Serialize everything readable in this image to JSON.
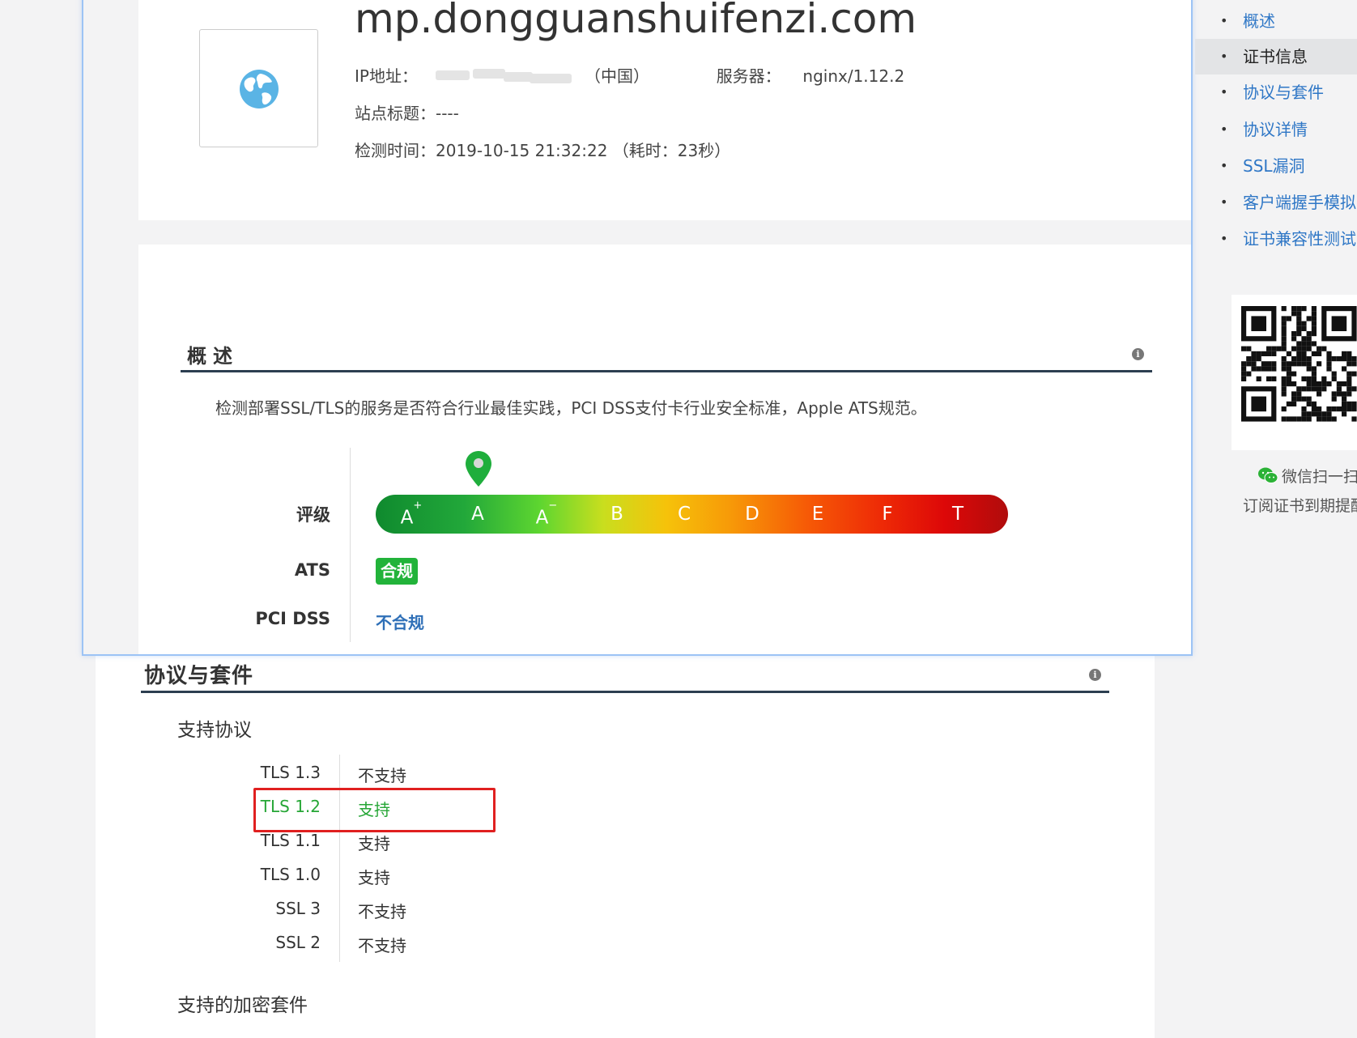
{
  "site": {
    "domain": "mp.dongguanshuifenzi.com",
    "ip_label": "IP地址：",
    "ip_country": "（中国）",
    "server_label": "服务器：",
    "server_value": "nginx/1.12.2",
    "title_label": "站点标题：",
    "title_value": "----",
    "time_label": "检测时间：",
    "time_value": "2019-10-15 21:32:22 （耗时：23秒）"
  },
  "overview": {
    "title": "概述",
    "description": "检测部署SSL/TLS的服务是否符合行业最佳实践，PCI DSS支付卡行业安全标准，Apple ATS规范。",
    "rating_label": "评级",
    "grades": [
      "A+",
      "A",
      "A-",
      "B",
      "C",
      "D",
      "E",
      "F",
      "T"
    ],
    "current_grade": "A",
    "ats_label": "ATS",
    "ats_value": "合规",
    "pci_label": "PCI DSS",
    "pci_value": "不合规"
  },
  "protocols": {
    "title": "协议与套件",
    "supported_title": "支持协议",
    "rows": [
      {
        "name": "TLS 1.3",
        "status": "不支持"
      },
      {
        "name": "TLS 1.2",
        "status": "支持"
      },
      {
        "name": "TLS 1.1",
        "status": "支持"
      },
      {
        "name": "TLS 1.0",
        "status": "支持"
      },
      {
        "name": "SSL 3",
        "status": "不支持"
      },
      {
        "name": "SSL 2",
        "status": "不支持"
      }
    ],
    "cipher_title": "支持的加密套件"
  },
  "sidebar": {
    "items": [
      {
        "label": "概述"
      },
      {
        "label": "证书信息"
      },
      {
        "label": "协议与套件"
      },
      {
        "label": "协议详情"
      },
      {
        "label": "SSL漏洞"
      },
      {
        "label": "客户端握手模拟"
      },
      {
        "label": "证书兼容性测试"
      }
    ],
    "active_index": 1,
    "wechat_text": "微信扫一扫",
    "subscribe_text": "订阅证书到期提醒"
  },
  "colors": {
    "link": "#2f77c6",
    "ok_green": "#26a636",
    "badge_green": "#22b33a",
    "fail_blue": "#2e6fb7",
    "highlight_red": "#e02020",
    "heading_rule": "#2c3e50"
  }
}
